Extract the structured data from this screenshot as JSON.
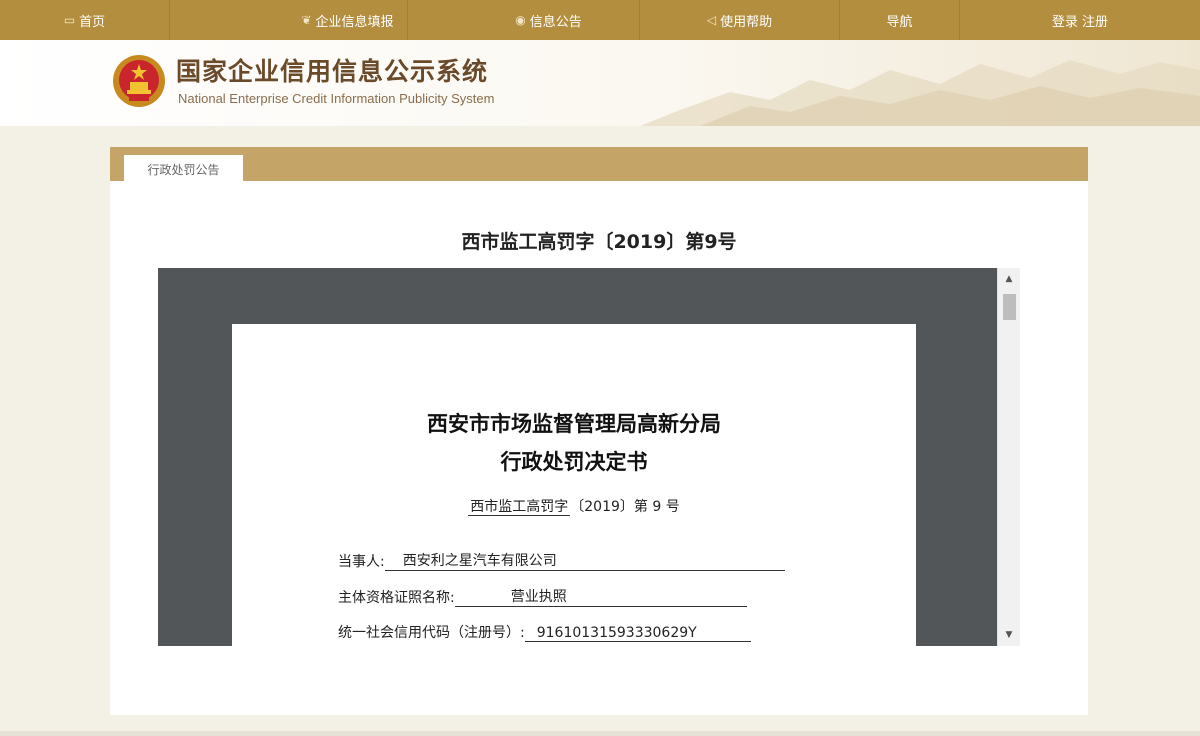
{
  "nav": {
    "items": [
      {
        "label": "首页",
        "icon": "monitor-icon"
      },
      {
        "label": "企业信息填报",
        "icon": "leaf-icon"
      },
      {
        "label": "信息公告",
        "icon": "megaphone-icon"
      },
      {
        "label": "使用帮助",
        "icon": "speaker-icon"
      },
      {
        "label": "导航"
      },
      {
        "label": "登录  注册"
      }
    ]
  },
  "header": {
    "title": "国家企业信用信息公示系统",
    "subtitle": "National Enterprise Credit Information Publicity System"
  },
  "panel": {
    "tab_label": "行政处罚公告",
    "doc_title": "西市监工高罚字〔2019〕第9号"
  },
  "document": {
    "org": "西安市市场监督管理局高新分局",
    "type": "行政处罚决定书",
    "ref_prefix": "西市监工高罚字",
    "ref_year": "〔2019〕",
    "ref_no": "第 9 号",
    "fields": [
      {
        "label": "当事人:",
        "value": "西安利之星汽车有限公司"
      },
      {
        "label": "主体资格证照名称:",
        "value": "营业执照"
      },
      {
        "label": "统一社会信用代码（注册号）:",
        "value": "91610131593330629Y"
      }
    ]
  },
  "colors": {
    "nav_bg": "#b38e3f",
    "panel_bar": "#c4a467",
    "viewer_bg": "#525659",
    "title_brown": "#6b4a2a"
  }
}
